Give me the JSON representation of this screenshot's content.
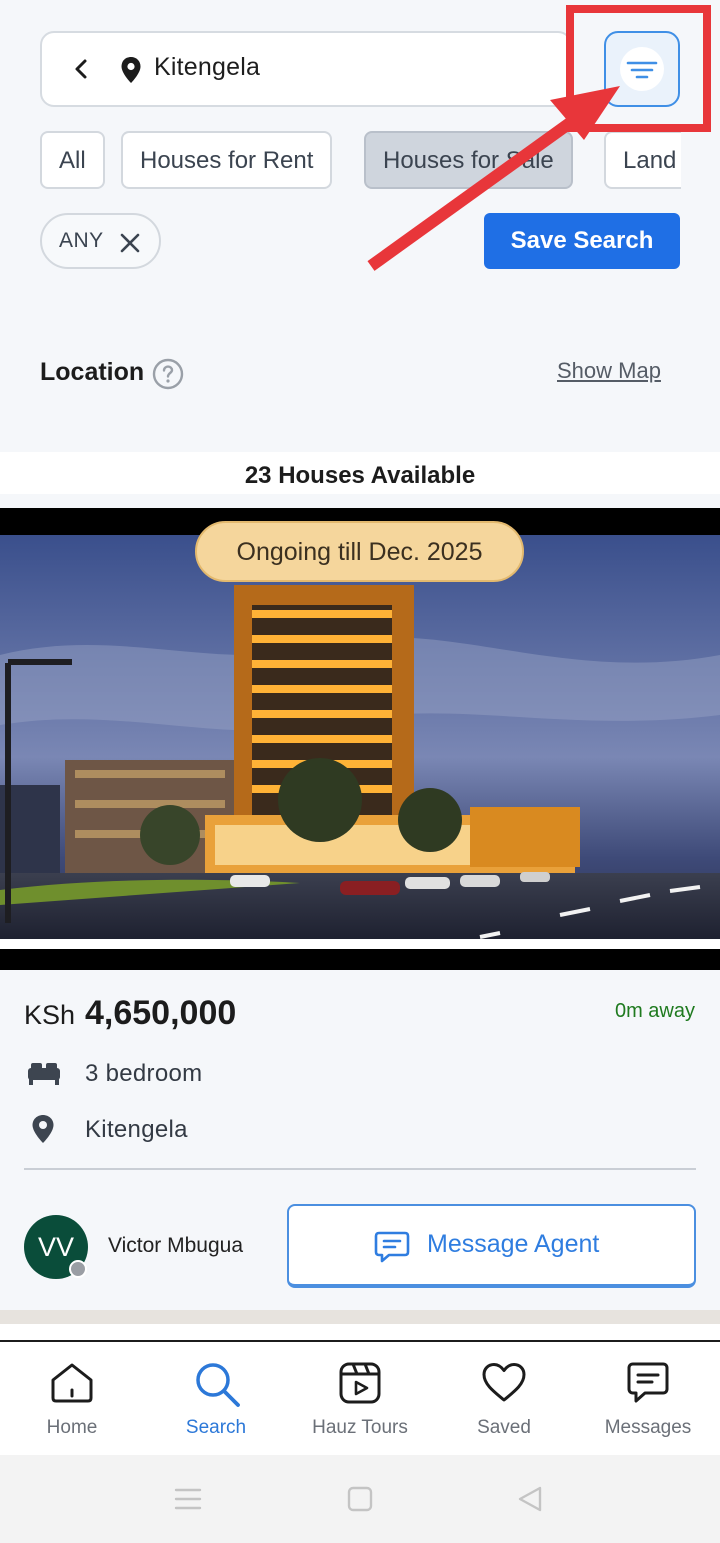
{
  "search": {
    "location_text": "Kitengela"
  },
  "filters": {
    "chips": [
      {
        "label": "All",
        "active": false
      },
      {
        "label": "Houses for Rent",
        "active": false
      },
      {
        "label": "Houses for Sale",
        "active": true
      },
      {
        "label": "Land",
        "active": false
      }
    ],
    "any_label": "ANY",
    "save_label": "Save Search"
  },
  "location_section": {
    "label": "Location",
    "show_map": "Show Map"
  },
  "results": {
    "count_text": "23 Houses Available"
  },
  "listing": {
    "badge": "Ongoing  till Dec. 2025",
    "currency": "KSh",
    "price": "4,650,000",
    "distance": "0m away",
    "bedrooms": "3 bedroom",
    "location": "Kitengela",
    "agent": {
      "initials": "VV",
      "name": "Victor Mbugua"
    },
    "message_label": "Message Agent"
  },
  "nav": {
    "items": [
      {
        "label": "Home",
        "icon": "home-icon",
        "active": false
      },
      {
        "label": "Search",
        "icon": "search-icon",
        "active": true
      },
      {
        "label": "Hauz Tours",
        "icon": "video-icon",
        "active": false
      },
      {
        "label": "Saved",
        "icon": "heart-icon",
        "active": false
      },
      {
        "label": "Messages",
        "icon": "chat-icon",
        "active": false
      }
    ]
  },
  "colors": {
    "primary": "#1f6fe5",
    "accent_link": "#2f7de0",
    "distance_green": "#1f7a1f",
    "badge_bg": "#f5d69c",
    "annotation_red": "#e8363a",
    "avatar_bg": "#0a4d3a"
  }
}
